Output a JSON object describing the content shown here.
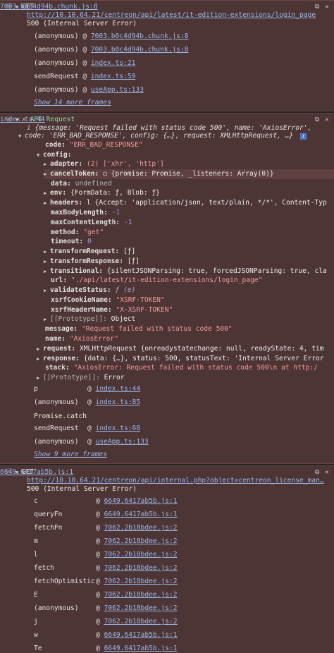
{
  "block1": {
    "method": "GET",
    "source": "7003.b0c4d94b.chunk.js:8",
    "url": "http://10.10.64.21/centreon/api/latest/it-edition-extensions/login_page",
    "status": "500 (Internal Server Error)",
    "stack": [
      {
        "fn": "(anonymous)",
        "link": "7003.b0c4d94b.chunk.js:8"
      },
      {
        "fn": "(anonymous)",
        "link": "7003.b0c4d94b.chunk.js:8"
      },
      {
        "fn": "(anonymous)",
        "link": "index.ts:21"
      },
      {
        "fn": "sendRequest",
        "link": "index.ts:59"
      },
      {
        "fn": "(anonymous)",
        "link": "useApp.ts:133"
      }
    ],
    "show_more": "Show 14 more frames"
  },
  "block2": {
    "label": "API Request",
    "source": "index.ts:44",
    "summary1": "{message: 'Request failed with status code 500', name: 'AxiosError',",
    "summary2": "code: 'ERR_BAD_RESPONSE', config: {…}, request: XMLHttpRequest, …}",
    "code_key": "code:",
    "code_val": "\"ERR_BAD_RESPONSE\"",
    "config_key": "config:",
    "adapter": {
      "k": "adapter:",
      "v": "(2) ['xhr', 'http']"
    },
    "cancelToken": {
      "k": "cancelToken:",
      "v": "○ {promise: Promise, _listeners: Array(0)}"
    },
    "data": {
      "k": "data:",
      "v": "undefined"
    },
    "env": {
      "k": "env:",
      "v": "{FormData: ƒ, Blob: ƒ}"
    },
    "headers": {
      "k": "headers:",
      "v": "l {Accept: 'application/json, text/plain, */*', Content-Typ"
    },
    "maxBodyLength": {
      "k": "maxBodyLength:",
      "v": "-1"
    },
    "maxContentLength": {
      "k": "maxContentLength:",
      "v": "-1"
    },
    "method": {
      "k": "method:",
      "v": "\"get\""
    },
    "timeout": {
      "k": "timeout:",
      "v": "0"
    },
    "transformRequest": {
      "k": "transformRequest:",
      "v": "[ƒ]"
    },
    "transformResponse": {
      "k": "transformResponse:",
      "v": "[ƒ]"
    },
    "transitional": {
      "k": "transitional:",
      "v": "{silentJSONParsing: true, forcedJSONParsing: true, cla"
    },
    "url": {
      "k": "url:",
      "v": "\"./api/latest/it-edition-extensions/login_page\""
    },
    "validateStatus": {
      "k": "validateStatus:",
      "v": "ƒ (e)"
    },
    "xsrfCookieName": {
      "k": "xsrfCookieName:",
      "v": "\"XSRF-TOKEN\""
    },
    "xsrfHeaderName": {
      "k": "xsrfHeaderName:",
      "v": "\"X-XSRF-TOKEN\""
    },
    "proto1": {
      "k": "[[Prototype]]:",
      "v": "Object"
    },
    "message": {
      "k": "message:",
      "v": "\"Request failed with status code 500\""
    },
    "name": {
      "k": "name:",
      "v": "\"AxiosError\""
    },
    "request": {
      "k": "request:",
      "v": "XMLHttpRequest {onreadystatechange: null, readyState: 4, tim"
    },
    "response": {
      "k": "response:",
      "v": "{data: {…}, status: 500, statusText: 'Internal Server Error"
    },
    "stack_row": {
      "k": "stack:",
      "v": "\"AxiosError: Request failed with status code 500\\n    at http:/"
    },
    "proto2": {
      "k": "[[Prototype]]:",
      "v": "Error"
    },
    "calls": [
      {
        "fn": "p",
        "link": "index.ts:44"
      },
      {
        "fn": "(anonymous)",
        "link": "index.ts:85"
      }
    ],
    "promise_catch": "Promise.catch",
    "calls2": [
      {
        "fn": "sendRequest",
        "link": "index.ts:68"
      },
      {
        "fn": "(anonymous)",
        "link": "useApp.ts:133"
      }
    ],
    "show_more": "Show 9 more frames"
  },
  "block3": {
    "method": "GET",
    "source": "6649.6417ab5b.js:1",
    "url": "http://10.10.64.21/centreon/api/internal.php?object=centreon_license_man…",
    "status": "500 (Internal Server Error)",
    "stack": [
      {
        "fn": "c",
        "link": "6649.6417ab5b.js:1"
      },
      {
        "fn": "queryFn",
        "link": "6649.6417ab5b.js:1"
      },
      {
        "fn": "fetchFn",
        "link": "7062.2b18bdee.js:2"
      },
      {
        "fn": "m",
        "link": "7062.2b18bdee.js:2"
      },
      {
        "fn": "l",
        "link": "7062.2b18bdee.js:2"
      },
      {
        "fn": "fetch",
        "link": "7062.2b18bdee.js:2"
      },
      {
        "fn": "fetchOptimistic",
        "link": "7062.2b18bdee.js:2"
      },
      {
        "fn": "E",
        "link": "7062.2b18bdee.js:2"
      },
      {
        "fn": "(anonymous)",
        "link": "7062.2b18bdee.js:2"
      },
      {
        "fn": "j",
        "link": "7062.2b18bdee.js:2"
      },
      {
        "fn": "w",
        "link": "6649.6417ab5b.js:1"
      },
      {
        "fn": "Te",
        "link": "6649.6417ab5b.js:1"
      }
    ]
  },
  "icons": {
    "error": "error-x-icon",
    "expand": "triangle-down-icon",
    "collapse": "triangle-right-icon",
    "info": "info-icon"
  }
}
